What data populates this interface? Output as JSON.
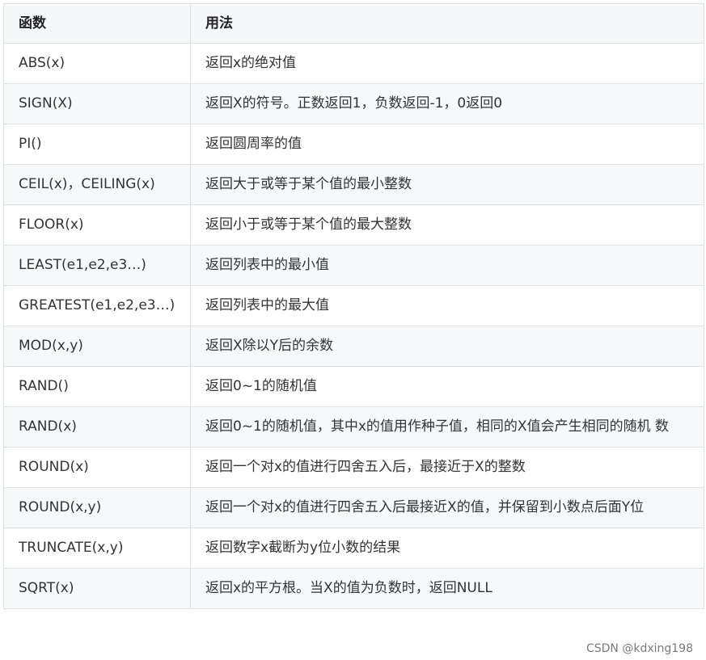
{
  "table": {
    "headers": [
      "函数",
      "用法"
    ],
    "rows": [
      {
        "fn": "ABS(x)",
        "usage": "返回x的绝对值"
      },
      {
        "fn": "SIGN(X)",
        "usage": "返回X的符号。正数返回1，负数返回-1，0返回0"
      },
      {
        "fn": "PI()",
        "usage": "返回圆周率的值"
      },
      {
        "fn": "CEIL(x)，CEILING(x)",
        "usage": "返回大于或等于某个值的最小整数"
      },
      {
        "fn": "FLOOR(x)",
        "usage": "返回小于或等于某个值的最大整数"
      },
      {
        "fn": "LEAST(e1,e2,e3…)",
        "usage": "返回列表中的最小值"
      },
      {
        "fn": "GREATEST(e1,e2,e3…)",
        "usage": "返回列表中的最大值"
      },
      {
        "fn": "MOD(x,y)",
        "usage": "返回X除以Y后的余数"
      },
      {
        "fn": "RAND()",
        "usage": "返回0~1的随机值"
      },
      {
        "fn": "RAND(x)",
        "usage": "返回0~1的随机值，其中x的值用作种子值，相同的X值会产生相同的随机 数"
      },
      {
        "fn": "ROUND(x)",
        "usage": "返回一个对x的值进行四舍五入后，最接近于X的整数"
      },
      {
        "fn": "ROUND(x,y)",
        "usage": "返回一个对x的值进行四舍五入后最接近X的值，并保留到小数点后面Y位"
      },
      {
        "fn": "TRUNCATE(x,y)",
        "usage": "返回数字x截断为y位小数的结果"
      },
      {
        "fn": "SQRT(x)",
        "usage": "返回x的平方根。当X的值为负数时，返回NULL"
      }
    ]
  },
  "watermark": "CSDN @kdxing198"
}
